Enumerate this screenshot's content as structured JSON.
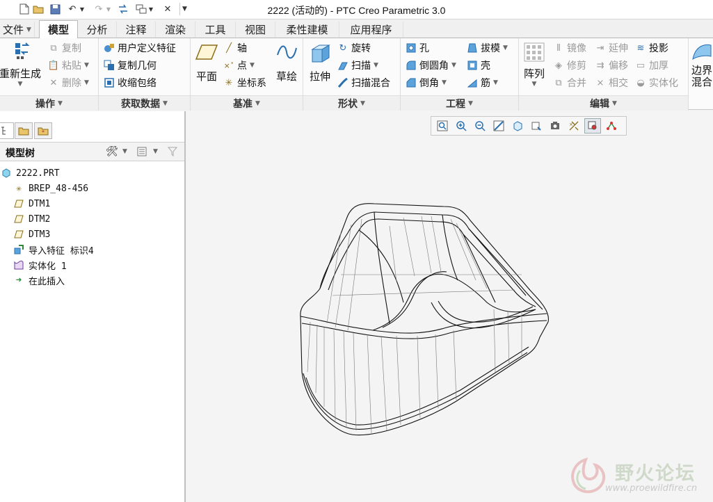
{
  "window": {
    "title": "2222 (活动的) - PTC Creo Parametric 3.0"
  },
  "quick_access": {
    "icons": [
      "new-file-icon",
      "open-folder-icon",
      "save-icon",
      "undo-icon",
      "redo-icon",
      "regenerate-icon",
      "windows-icon",
      "close-window-icon",
      "customize-dropdown-icon"
    ]
  },
  "tabs": [
    "文件",
    "模型",
    "分析",
    "注释",
    "渲染",
    "工具",
    "视图",
    "柔性建模",
    "应用程序"
  ],
  "active_tab": "模型",
  "ribbon": {
    "operations": {
      "label": "操作",
      "regenerate": "重新生成",
      "copy": "复制",
      "paste": "粘贴",
      "delete": "删除"
    },
    "get_data": {
      "label": "获取数据",
      "udf": "用户定义特征",
      "copy_geometry": "复制几何",
      "shrinkwrap": "收缩包络"
    },
    "datum": {
      "label": "基准",
      "plane": "平面",
      "axis": "轴",
      "point": "点",
      "csys": "坐标系",
      "sketch": "草绘"
    },
    "shapes": {
      "label": "形状",
      "extrude": "拉伸",
      "revolve": "旋转",
      "sweep": "扫描",
      "swept_blend": "扫描混合"
    },
    "engineering": {
      "label": "工程",
      "hole": "孔",
      "round": "倒圆角",
      "chamfer": "倒角",
      "draft": "拔模",
      "shell": "壳",
      "rib": "筋"
    },
    "editing": {
      "label": "编辑",
      "pattern": "阵列",
      "mirror": "镜像",
      "trim": "修剪",
      "merge": "合并",
      "extend": "延伸",
      "offset": "偏移",
      "intersect": "相交",
      "project": "投影",
      "thicken": "加厚",
      "solidify": "实体化"
    },
    "surfaces": {
      "boundary_blend_1": "边界",
      "boundary_blend_2": "混合"
    }
  },
  "model_tree": {
    "title": "模型树",
    "items": [
      {
        "label": "2222.PRT",
        "icon": "part-icon",
        "indent": 0
      },
      {
        "label": "BREP_48-456",
        "icon": "csys-icon",
        "indent": 1
      },
      {
        "label": "DTM1",
        "icon": "datum-plane-icon",
        "indent": 1
      },
      {
        "label": "DTM2",
        "icon": "datum-plane-icon",
        "indent": 1
      },
      {
        "label": "DTM3",
        "icon": "datum-plane-icon",
        "indent": 1
      },
      {
        "label": "导入特征 标识4",
        "icon": "import-feature-icon",
        "indent": 1
      },
      {
        "label": "实体化 1",
        "icon": "solidify-icon",
        "indent": 1
      },
      {
        "label": "在此插入",
        "icon": "insert-here-arrow-icon",
        "indent": 1
      }
    ]
  },
  "view_toolbar": {
    "icons": [
      "refit-icon",
      "zoom-in-icon",
      "zoom-out-icon",
      "repaint-icon",
      "display-style-icon",
      "saved-orientations-icon",
      "view-manager-icon",
      "datum-display-icon",
      "spin-center-icon",
      "annotation-display-icon"
    ]
  },
  "watermark": {
    "text": "野火论坛",
    "url": "www.proewildfire.cn"
  },
  "colors": {
    "ribbon_bg": "#fbfbfb",
    "tab_active_bg": "#ffffff",
    "canvas_bg": "#f4f4f4",
    "model_line": "#111111",
    "watermark_green": "#cfd9c9"
  }
}
